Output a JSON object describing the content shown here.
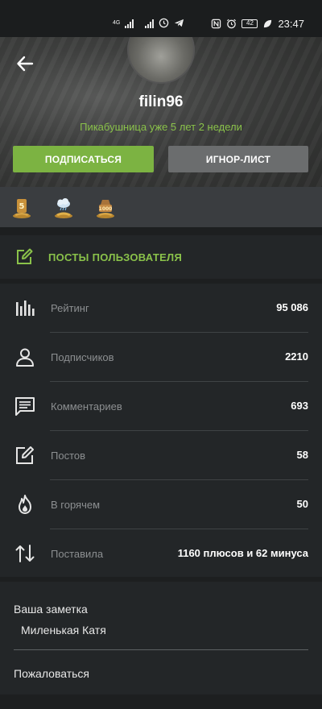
{
  "status_bar": {
    "network": "4G",
    "time": "23:47",
    "battery": "42",
    "icons": [
      "signal-icon",
      "signal-icon",
      "alarm-icon",
      "telegram-icon",
      "nfc-icon",
      "alarm-clock-icon",
      "battery-icon",
      "leaf-icon"
    ]
  },
  "profile": {
    "username": "filin96",
    "since": "Пикабушница уже 5 лет 2 недели",
    "subscribe_label": "ПОДПИСАТЬСЯ",
    "ignore_label": "ИГНОР-ЛИСТ"
  },
  "awards": [
    "award-5-years-icon",
    "award-cloud-icon",
    "award-1000-icon"
  ],
  "posts_link": {
    "label": "ПОСТЫ ПОЛЬЗОВАТЕЛЯ"
  },
  "stats": [
    {
      "icon": "rating-icon",
      "label": "Рейтинг",
      "value": "95 086"
    },
    {
      "icon": "user-icon",
      "label": "Подписчиков",
      "value": "2210"
    },
    {
      "icon": "comment-icon",
      "label": "Комментариев",
      "value": "693"
    },
    {
      "icon": "edit-icon",
      "label": "Постов",
      "value": "58"
    },
    {
      "icon": "fire-icon",
      "label": "В горячем",
      "value": "50"
    },
    {
      "icon": "sort-icon",
      "label": "Поставила",
      "value": "1160 плюсов и 62 минуса"
    }
  ],
  "notes": {
    "title": "Ваша заметка",
    "text": "Миленькая Катя",
    "report_label": "Пожаловаться"
  },
  "colors": {
    "accent_green": "#8ac24a",
    "button_green": "#7cb342",
    "button_grey": "#6b6d6e",
    "panel": "#232628",
    "background": "#1d1f20"
  }
}
